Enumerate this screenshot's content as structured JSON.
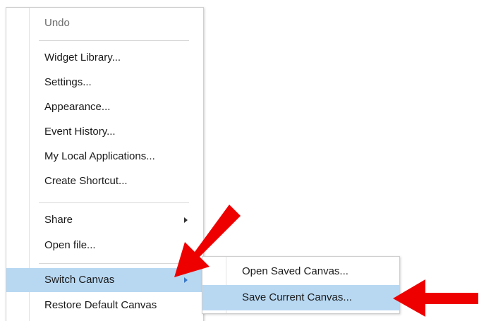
{
  "context_menu": {
    "items": [
      {
        "label": "Undo"
      },
      {
        "label": "Widget Library..."
      },
      {
        "label": "Settings..."
      },
      {
        "label": "Appearance..."
      },
      {
        "label": "Event History..."
      },
      {
        "label": "My Local Applications..."
      },
      {
        "label": "Create Shortcut..."
      },
      {
        "label": "Share"
      },
      {
        "label": "Open file..."
      },
      {
        "label": "Switch Canvas"
      },
      {
        "label": "Restore Default Canvas"
      }
    ]
  },
  "submenu": {
    "items": [
      {
        "label": "Open Saved Canvas..."
      },
      {
        "label": "Save Current Canvas..."
      }
    ]
  },
  "colors": {
    "highlight": "#b8d8f2",
    "annotation_arrow": "#ee0000",
    "submenu_arrow": "#3b79c8"
  }
}
